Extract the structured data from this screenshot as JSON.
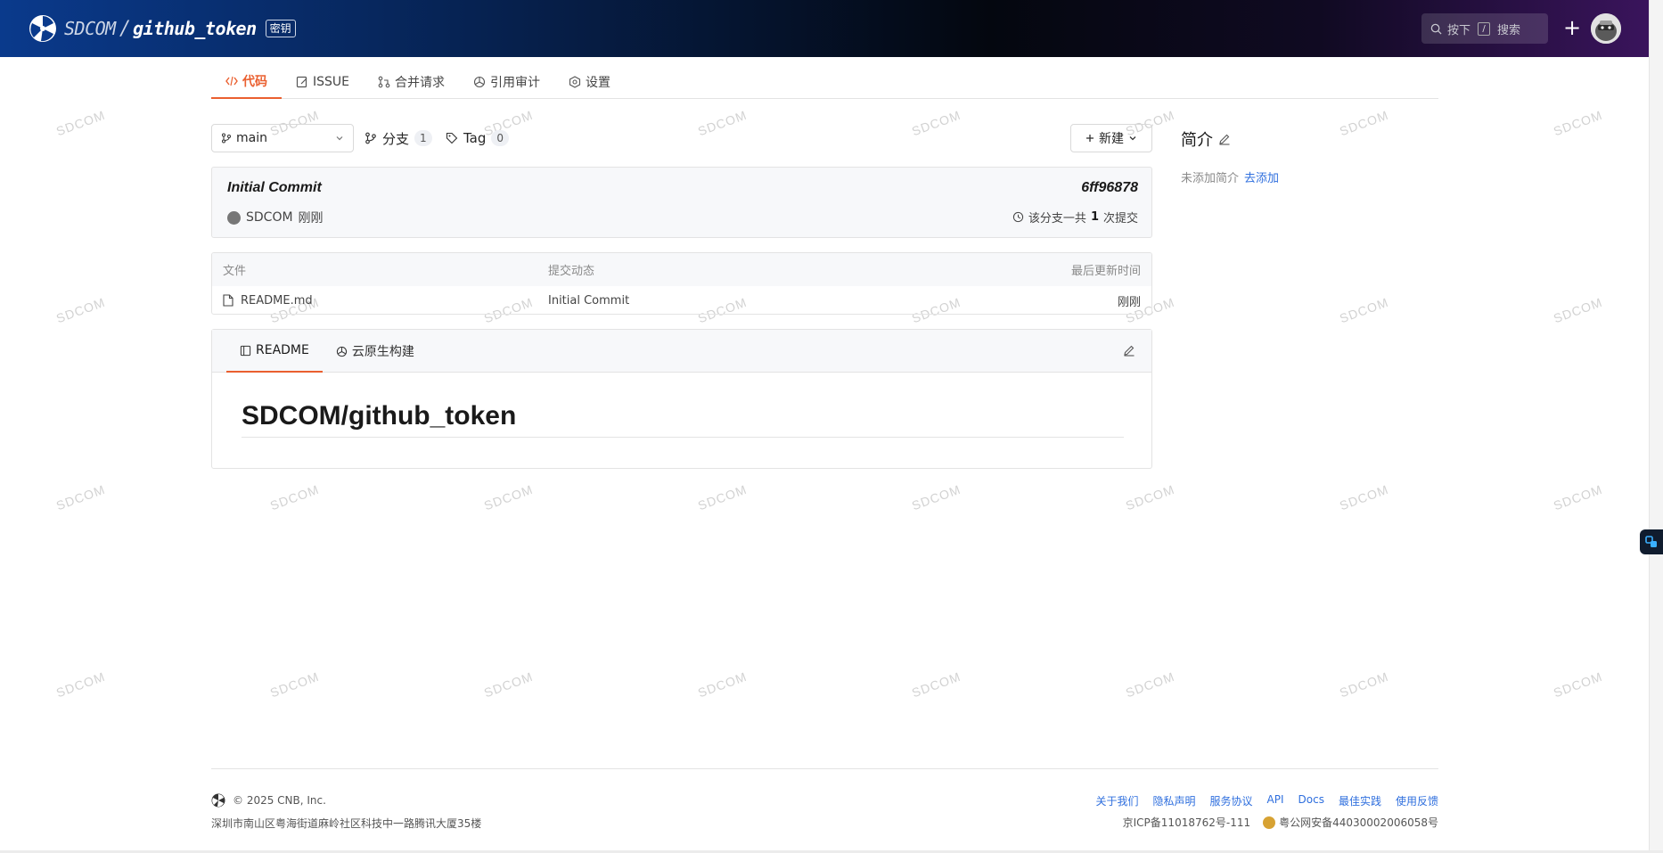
{
  "header": {
    "org": "SDCOM",
    "separator": "/",
    "repo": "github_token",
    "badge": "密钥",
    "search": {
      "prefix": "按下",
      "key": "/",
      "suffix": "搜索"
    },
    "plus_label": "+"
  },
  "tabs": [
    {
      "label": "代码",
      "icon": "code-icon"
    },
    {
      "label": "ISSUE",
      "icon": "issue-icon"
    },
    {
      "label": "合并请求",
      "icon": "merge-request-icon"
    },
    {
      "label": "引用审计",
      "icon": "audit-icon"
    },
    {
      "label": "设置",
      "icon": "settings-icon"
    }
  ],
  "branch": {
    "current": "main"
  },
  "branches": {
    "label": "分支",
    "count": "1"
  },
  "tags": {
    "label": "Tag",
    "count": "0"
  },
  "new_button": {
    "label": "新建"
  },
  "commit": {
    "title": "Initial Commit",
    "sha": "6ff96878",
    "author": "SDCOM",
    "time": "刚刚",
    "count_prefix": "该分支一共",
    "count": "1",
    "count_suffix": "次提交"
  },
  "files": {
    "headers": [
      "文件",
      "提交动态",
      "最后更新时间"
    ],
    "rows": [
      {
        "name": "README.md",
        "commit": "Initial Commit",
        "updated": "刚刚"
      }
    ]
  },
  "readme": {
    "tabs": [
      "README",
      "云原生构建"
    ],
    "heading": "SDCOM/github_token"
  },
  "about": {
    "title": "简介",
    "empty": "未添加简介",
    "add": "去添加"
  },
  "footer": {
    "copyright": "© 2025 CNB, Inc.",
    "address": "深圳市南山区粤海街道麻岭社区科技中一路腾讯大厦35楼",
    "links": [
      "关于我们",
      "隐私声明",
      "服务协议",
      "API",
      "Docs",
      "最佳实践",
      "使用反馈"
    ],
    "icp": "京ICP备11018762号-111",
    "police": "粤公网安备44030002006058号"
  },
  "watermark": "SDCOM",
  "colors": {
    "accent": "#ea5f2f",
    "link": "#2f6fde"
  }
}
